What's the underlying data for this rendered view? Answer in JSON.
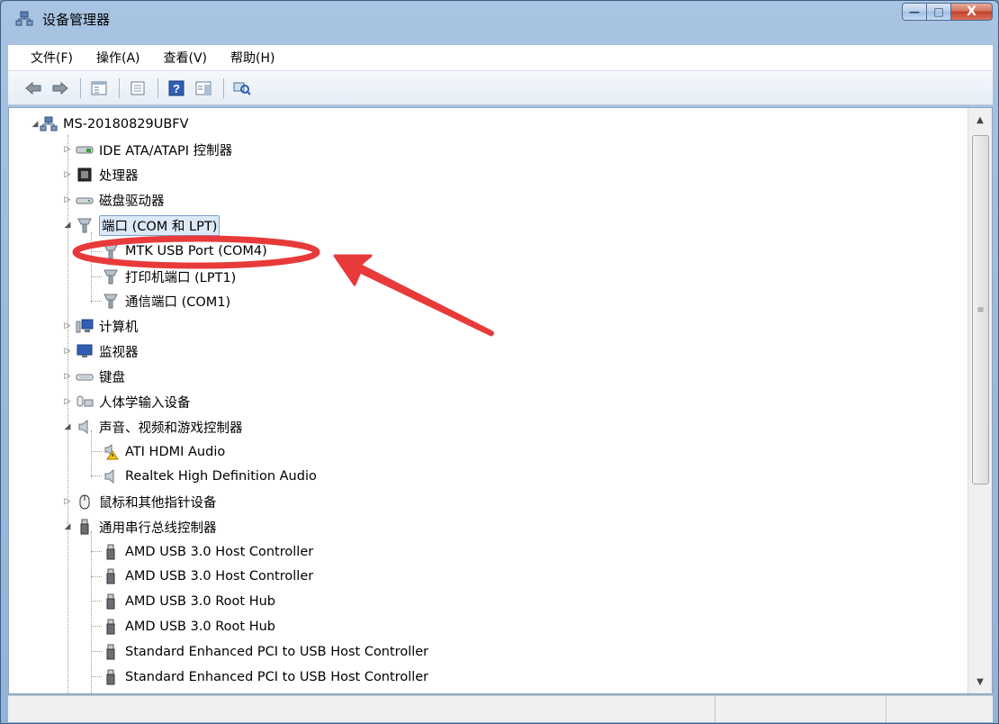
{
  "window": {
    "title": "设备管理器",
    "caption_buttons": {
      "minimize": "—",
      "maximize": "□",
      "close": "X"
    }
  },
  "menu": [
    {
      "label": "文件(F)"
    },
    {
      "label": "操作(A)"
    },
    {
      "label": "查看(V)"
    },
    {
      "label": "帮助(H)"
    }
  ],
  "toolbar": {
    "buttons": [
      "back-icon",
      "forward-icon",
      "show-hide-tree-icon",
      "properties-icon",
      "help-icon",
      "action-pane-icon",
      "scan-hardware-icon"
    ]
  },
  "tree": {
    "root": "MS-20180829UBFV",
    "nodes": [
      {
        "label": "IDE ATA/ATAPI 控制器",
        "icon": "ide-controller-icon"
      },
      {
        "label": "处理器",
        "icon": "processor-icon"
      },
      {
        "label": "磁盘驱动器",
        "icon": "disk-drive-icon"
      },
      {
        "label": "端口 (COM 和 LPT)",
        "icon": "port-icon"
      },
      {
        "label": "MTK USB Port (COM4)",
        "icon": "port-icon"
      },
      {
        "label": "打印机端口 (LPT1)",
        "icon": "port-icon"
      },
      {
        "label": "通信端口 (COM1)",
        "icon": "port-icon"
      },
      {
        "label": "计算机",
        "icon": "computer-icon"
      },
      {
        "label": "监视器",
        "icon": "monitor-icon"
      },
      {
        "label": "键盘",
        "icon": "keyboard-icon"
      },
      {
        "label": "人体学输入设备",
        "icon": "hid-icon"
      },
      {
        "label": "声音、视频和游戏控制器",
        "icon": "speaker-icon"
      },
      {
        "label": "ATI HDMI Audio",
        "icon": "speaker-warning-icon"
      },
      {
        "label": "Realtek High Definition Audio",
        "icon": "speaker-icon"
      },
      {
        "label": "鼠标和其他指针设备",
        "icon": "mouse-icon"
      },
      {
        "label": "通用串行总线控制器",
        "icon": "usb-icon"
      },
      {
        "label": "AMD USB 3.0 Host Controller",
        "icon": "usb-icon"
      },
      {
        "label": "AMD USB 3.0 Host Controller",
        "icon": "usb-icon"
      },
      {
        "label": "AMD USB 3.0 Root Hub",
        "icon": "usb-icon"
      },
      {
        "label": "AMD USB 3.0 Root Hub",
        "icon": "usb-icon"
      },
      {
        "label": "Standard Enhanced PCI to USB Host Controller",
        "icon": "usb-icon"
      },
      {
        "label": "Standard Enhanced PCI to USB Host Controller",
        "icon": "usb-icon"
      }
    ]
  },
  "colors": {
    "annotation": "#e83a3a",
    "selection": "#dce9f8",
    "frame": "#9dbbdc"
  }
}
